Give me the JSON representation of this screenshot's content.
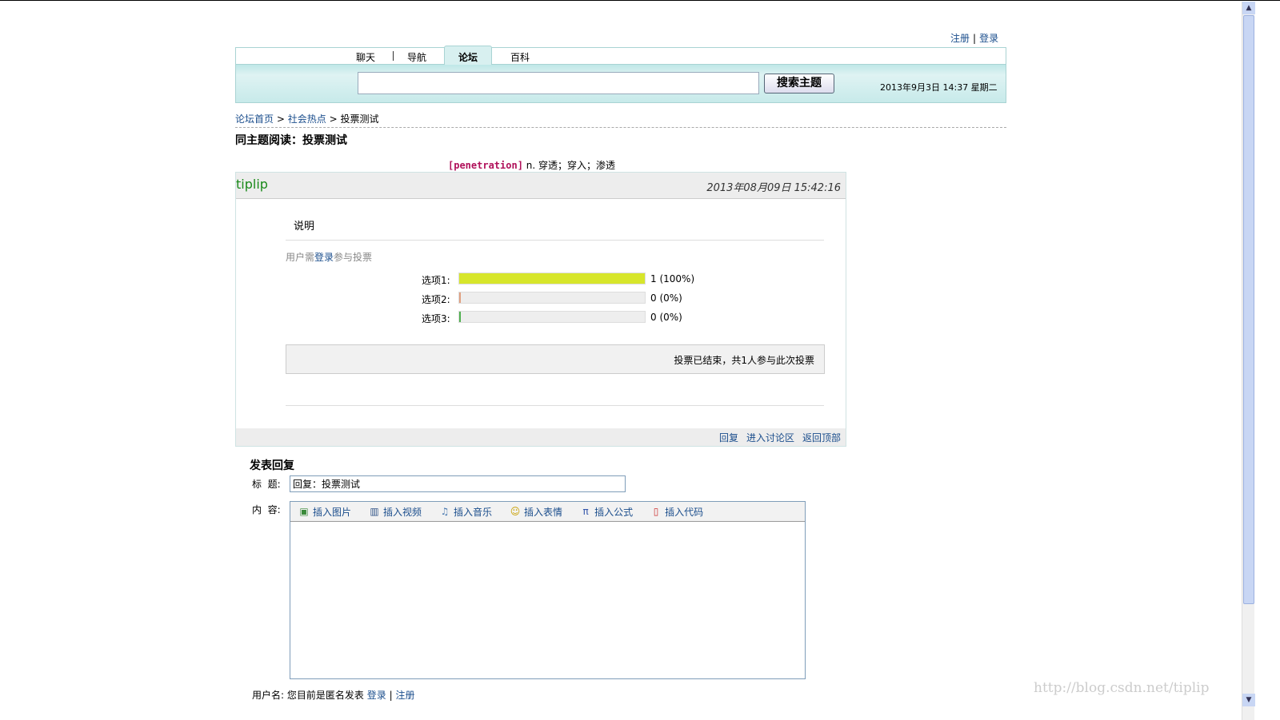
{
  "top_links": {
    "register": "注册",
    "sep": "|",
    "login": "登录"
  },
  "nav": {
    "tabs": [
      {
        "label": "聊天"
      },
      {
        "label": "导航"
      },
      {
        "label": "论坛"
      },
      {
        "label": "百科"
      }
    ],
    "search_placeholder": "",
    "search_button": "搜索主题",
    "date": "2013年9月3日 14:37 星期二"
  },
  "breadcrumb": {
    "home": "论坛首页",
    "sep": ">",
    "section": "社会热点",
    "current": "投票测试"
  },
  "page_title": "同主题阅读：投票测试",
  "dict": {
    "word": "[penetration]",
    "definition": " n. 穿透；穿入；渗透"
  },
  "post": {
    "author": "tiplip",
    "time": "2013年08月09日 15:42:16",
    "description": "说明",
    "vote_hint_pre": "用户需",
    "vote_hint_link": "登录",
    "vote_hint_post": "参与投票",
    "options": [
      {
        "label": "选项1:",
        "percent": 100,
        "count_text": "1 (100%)",
        "color": "#d7e62b"
      },
      {
        "label": "选项2:",
        "percent": 0,
        "count_text": "0 (0%)",
        "color": "#e0a080"
      },
      {
        "label": "选项3:",
        "percent": 0,
        "count_text": "0 (0%)",
        "color": "#50b050"
      }
    ],
    "vote_status": "投票已结束，共1人参与此次投票",
    "footer_links": [
      "回复",
      "进入讨论区",
      "返回顶部"
    ]
  },
  "reply": {
    "title": "发表回复",
    "subject_label": "标  题:",
    "subject_value": "回复：投票测试",
    "content_label": "内  容:",
    "toolbar": [
      {
        "icon": "image-icon",
        "label": "插入图片"
      },
      {
        "icon": "video-icon",
        "label": "插入视频"
      },
      {
        "icon": "music-icon",
        "label": "插入音乐"
      },
      {
        "icon": "smiley-icon",
        "label": "插入表情"
      },
      {
        "icon": "pi-icon",
        "label": "插入公式"
      },
      {
        "icon": "code-file-icon",
        "label": "插入代码"
      }
    ],
    "user_label": "用户名:",
    "user_text": "您目前是匿名发表",
    "login": "登录",
    "sep": "|",
    "register": "注册"
  },
  "watermark": "http://blog.csdn.net/tiplip"
}
